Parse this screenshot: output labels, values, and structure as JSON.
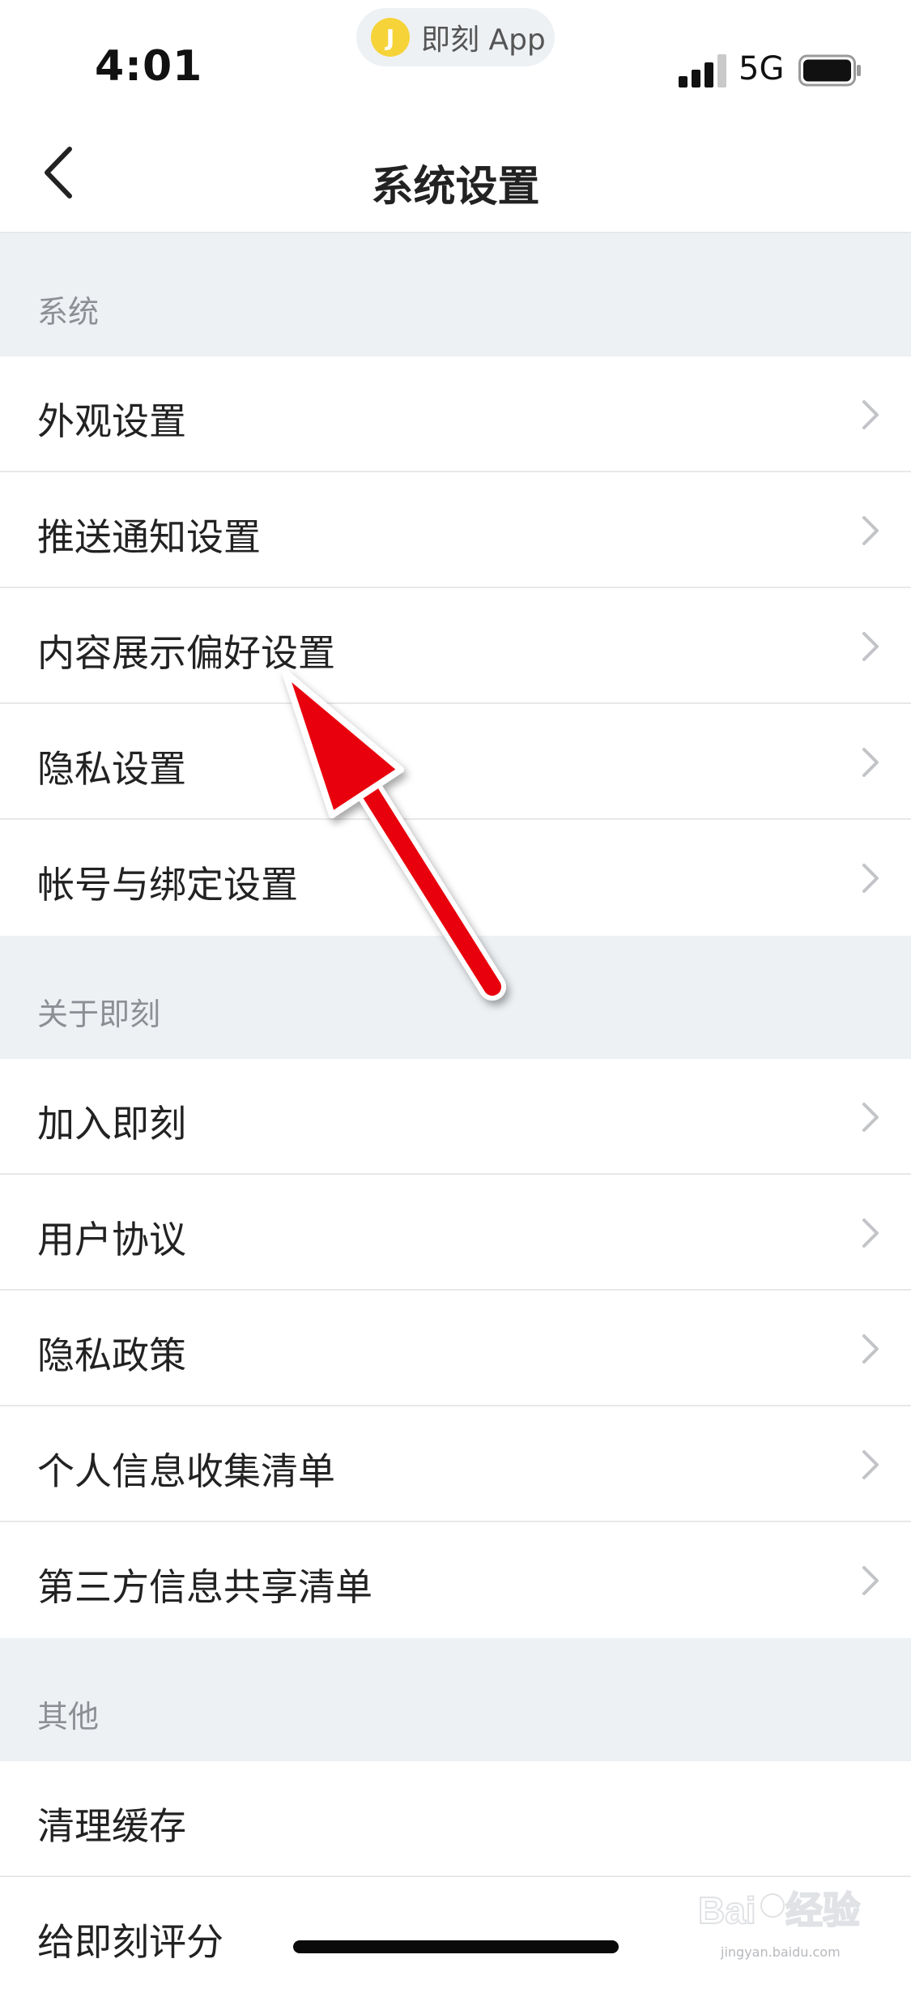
{
  "status_bar": {
    "time": "4:01",
    "app_name": "即刻 App",
    "app_logo_letter": "J",
    "network": "5G"
  },
  "nav": {
    "title": "系统设置",
    "back_icon": "chevron-left-icon"
  },
  "sections": [
    {
      "header": "系统",
      "items": [
        "外观设置",
        "推送通知设置",
        "内容展示偏好设置",
        "隐私设置",
        "帐号与绑定设置"
      ]
    },
    {
      "header": "关于即刻",
      "items": [
        "加入即刻",
        "用户协议",
        "隐私政策",
        "个人信息收集清单",
        "第三方信息共享清单"
      ]
    },
    {
      "header": "其他",
      "items": [
        "清理缓存",
        "给即刻评分"
      ]
    }
  ],
  "colors": {
    "section_background": "#eef1f4",
    "annotation_arrow": "#e8000b",
    "app_logo": "#f6d339"
  },
  "watermark": {
    "brand": "Baidu经验",
    "url": "jingyan.baidu.com"
  }
}
